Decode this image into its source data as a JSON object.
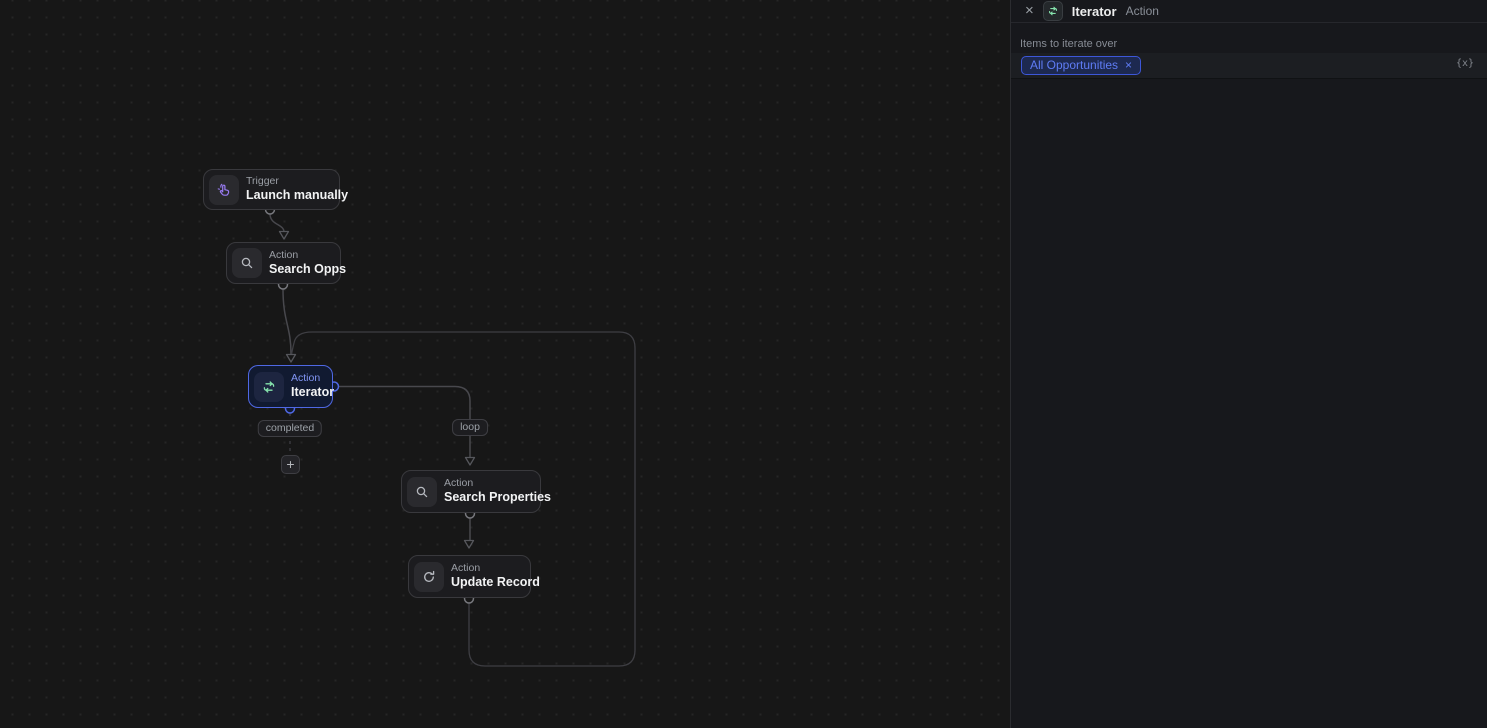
{
  "colors": {
    "canvas_bg": "#171717",
    "panel_bg": "#17181c",
    "node_bg": "#1c1c1f",
    "node_border": "#39393d",
    "selected_node_bg": "#111a31",
    "accent_blue": "#4f68e4",
    "chip_text": "#5f7cf5",
    "chip_bg": "#1d2950",
    "trigger_purple": "#9a7cf5",
    "iterator_green": "#86e3ad",
    "edge_gray": "#48484d"
  },
  "canvas": {
    "nodes": [
      {
        "category": "Trigger",
        "name": "Launch manually",
        "icon": "hand-click-icon"
      },
      {
        "category": "Action",
        "name": "Search Opps",
        "icon": "search-icon"
      },
      {
        "category": "Action",
        "name": "Iterator",
        "icon": "repeat-icon",
        "selected": true
      },
      {
        "category": "Action",
        "name": "Search Properties",
        "icon": "search-icon"
      },
      {
        "category": "Action",
        "name": "Update Record",
        "icon": "refresh-icon"
      }
    ],
    "edge_labels": {
      "completed": "completed",
      "loop": "loop"
    },
    "add_button": "+"
  },
  "panel": {
    "header": {
      "close": "×",
      "title": "Iterator",
      "type": "Action",
      "icon": "repeat-icon"
    },
    "field": {
      "label": "Items to iterate over",
      "chip": "All Opportunities",
      "chip_remove": "×",
      "variable_button": "{x}"
    }
  }
}
